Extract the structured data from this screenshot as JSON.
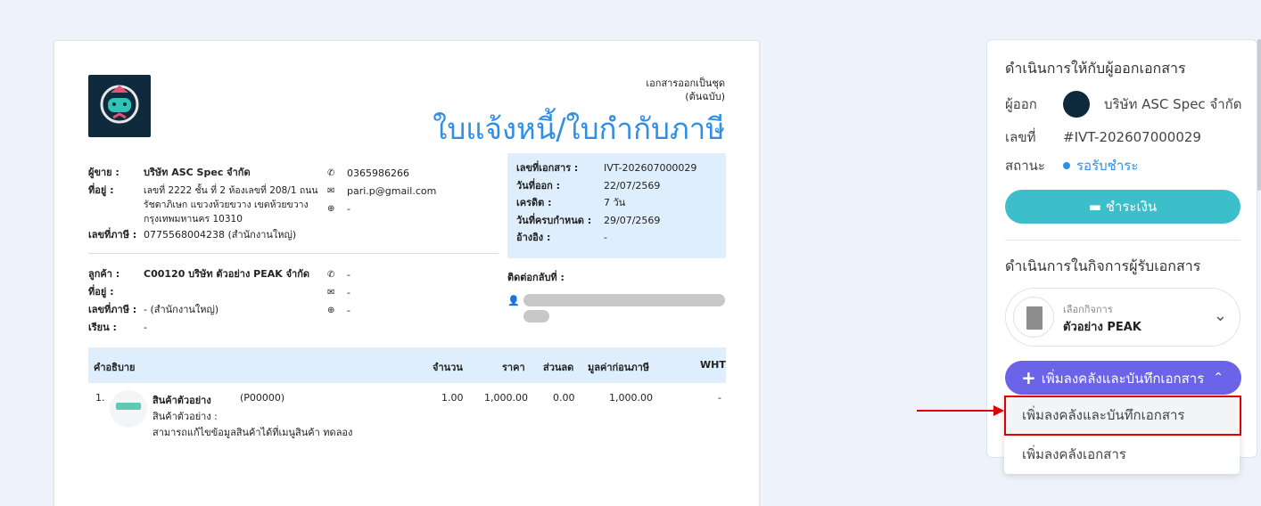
{
  "document": {
    "note_line1": "เอกสารออกเป็นชุด",
    "note_line2": "(ต้นฉบับ)",
    "title": "ใบแจ้งหนี้/ใบกำกับภาษี",
    "seller": {
      "label_name": "ผู้ขาย :",
      "name": "บริษัท ASC Spec จำกัด",
      "label_address": "ที่อยู่ :",
      "address": "เลขที่ 2222 ชั้น ที่ 2 ห้องเลขที่ 208/1 ถนนรัชดาภิเษก แขวงห้วยขวาง เขตห้วยขวาง กรุงเทพมหานคร 10310",
      "label_tax": "เลขที่ภาษี :",
      "tax": "0775568004238 (สำนักงานใหญ่)",
      "phone": "0365986266",
      "email": "pari.p@gmail.com",
      "web": "-"
    },
    "buyer": {
      "label_name": "ลูกค้า :",
      "name": "C00120 บริษัท ตัวอย่าง PEAK จำกัด",
      "label_address": "ที่อยู่ :",
      "address": "",
      "label_tax": "เลขที่ภาษี :",
      "tax": "- (สำนักงานใหญ่)",
      "label_attn": "เรียน :",
      "attn": "-",
      "phone": "-",
      "email": "-",
      "web": "-"
    },
    "info": {
      "doc_no_label": "เลขที่เอกสาร :",
      "doc_no": "IVT-202607000029",
      "date_label": "วันที่ออก :",
      "date": "22/07/2569",
      "credit_label": "เครดิต :",
      "credit": "7 วัน",
      "due_label": "วันที่ครบกำหนด :",
      "due": "29/07/2569",
      "ref_label": "อ้างอิง :",
      "ref": "-"
    },
    "contact_back_label": "ติดต่อกลับที่ :",
    "table": {
      "headers": [
        "คำอธิบาย",
        "จำนวน",
        "ราคา",
        "ส่วนลด",
        "มูลค่าก่อนภาษี",
        "WHT"
      ],
      "items": [
        {
          "no": "1.",
          "name": "สินค้าตัวอย่าง",
          "code": "(P00000)",
          "desc1": "สินค้าตัวอย่าง :",
          "desc2": "สามารถแก้ไขข้อมูลสินค้าได้ที่เมนูสินค้า ทดลอง",
          "qty": "1.00",
          "price": "1,000.00",
          "discount": "0.00",
          "pretax": "1,000.00",
          "wht": "-"
        }
      ]
    }
  },
  "sidebar": {
    "issuer_heading": "ดำเนินการให้กับผู้ออกเอกสาร",
    "issuer_label": "ผู้ออก",
    "issuer_name": "บริษัท ASC Spec จำกัด",
    "number_label": "เลขที่",
    "number": "#IVT-202607000029",
    "status_label": "สถานะ",
    "status": "รอรับชำระ",
    "pay_button": "ชำระเงิน",
    "receiver_heading": "ดำเนินการในกิจการผู้รับเอกสาร",
    "business_select_label": "เลือกกิจการ",
    "business_name": "ตัวอย่าง PEAK",
    "add_button": "เพิ่มลงคลังและบันทึกเอกสาร",
    "menu": [
      "เพิ่มลงคลังและบันทึกเอกสาร",
      "เพิ่มลงคลังเอกสาร"
    ]
  },
  "colors": {
    "accent": "#2f8fe6",
    "pay": "#3dbfcb",
    "primary": "#6b63e8",
    "highlight": "#e00000"
  }
}
